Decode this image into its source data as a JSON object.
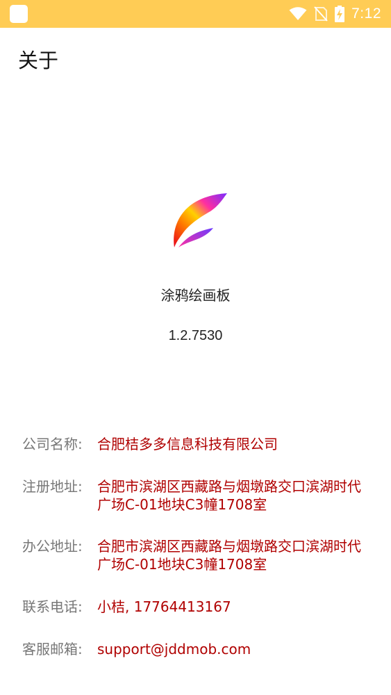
{
  "status_bar": {
    "time": "7:12",
    "icons": [
      "app-notification-icon",
      "wifi-icon",
      "no-signal-icon",
      "battery-charging-icon"
    ],
    "color": "#FFCC55"
  },
  "header": {
    "title": "关于"
  },
  "app": {
    "logo_icon": "feather-logo-icon",
    "name": "涂鸦绘画板",
    "version": "1.2.7530"
  },
  "info": {
    "rows": [
      {
        "label": "公司名称:",
        "value": "合肥桔多多信息科技有限公司"
      },
      {
        "label": "注册地址:",
        "value": "合肥市滨湖区西藏路与烟墩路交口滨湖时代广场C-01地块C3幢1708室"
      },
      {
        "label": "办公地址:",
        "value": "合肥市滨湖区西藏路与烟墩路交口滨湖时代广场C-01地块C3幢1708室"
      },
      {
        "label": "联系电话:",
        "value": "小桔, 17764413167"
      },
      {
        "label": "客服邮箱:",
        "value": "support@jddmob.com"
      }
    ],
    "value_color": "#B00000"
  }
}
